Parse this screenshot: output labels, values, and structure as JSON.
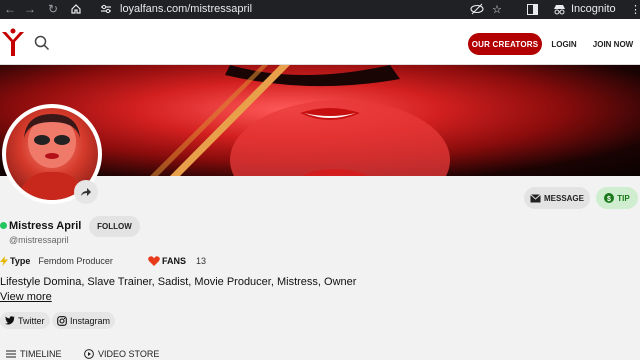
{
  "browser": {
    "url": "loyalfans.com/mistressapril",
    "mode_label": "Incognito"
  },
  "header": {
    "our_creators": "OUR CREATORS",
    "login": "LOGIN",
    "join_now": "JOIN NOW"
  },
  "profile": {
    "name": "Mistress April",
    "handle": "@mistressapril",
    "follow_label": "FOLLOW",
    "message_label": "MESSAGE",
    "tip_label": "TIP",
    "type_label": "Type",
    "type_value": "Femdom Producer",
    "fans_label": "FANS",
    "fans_count": "13",
    "bio": "Lifestyle Domina, Slave Trainer, Sadist, Movie Producer, Mistress, Owner",
    "view_more": "View more"
  },
  "social": [
    {
      "label": "Twitter"
    },
    {
      "label": "Instagram"
    }
  ],
  "tabs": [
    {
      "label": "TIMELINE"
    },
    {
      "label": "VIDEO STORE"
    }
  ],
  "colors": {
    "brand_red": "#b30000",
    "online": "#22c55e",
    "tip_green": "#1a7a1a"
  }
}
